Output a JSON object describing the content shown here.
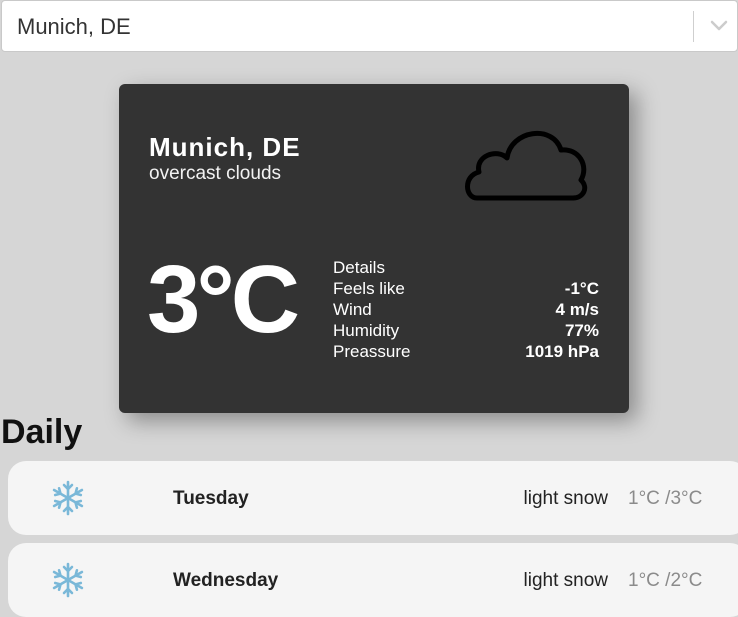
{
  "search": {
    "value": "Munich, DE"
  },
  "current": {
    "city": "Munich, DE",
    "description": "overcast clouds",
    "icon": "cloud-icon",
    "temperature": "3°C",
    "details_label": "Details",
    "details": [
      {
        "label": "Feels like",
        "value": "-1°C"
      },
      {
        "label": "Wind",
        "value": "4 m/s"
      },
      {
        "label": "Humidity",
        "value": "77%"
      },
      {
        "label": "Preassure",
        "value": "1019 hPa"
      }
    ]
  },
  "daily": {
    "title": "Daily",
    "days": [
      {
        "icon": "snowflake-icon",
        "day": "Tuesday",
        "description": "light snow",
        "range": "1°C /3°C"
      },
      {
        "icon": "snowflake-icon",
        "day": "Wednesday",
        "description": "light snow",
        "range": "1°C /2°C"
      }
    ]
  },
  "colors": {
    "background": "#d6d6d6",
    "card": "#333333",
    "snow_icon": "#7ab8d8",
    "range_text": "#8b8b8b"
  }
}
